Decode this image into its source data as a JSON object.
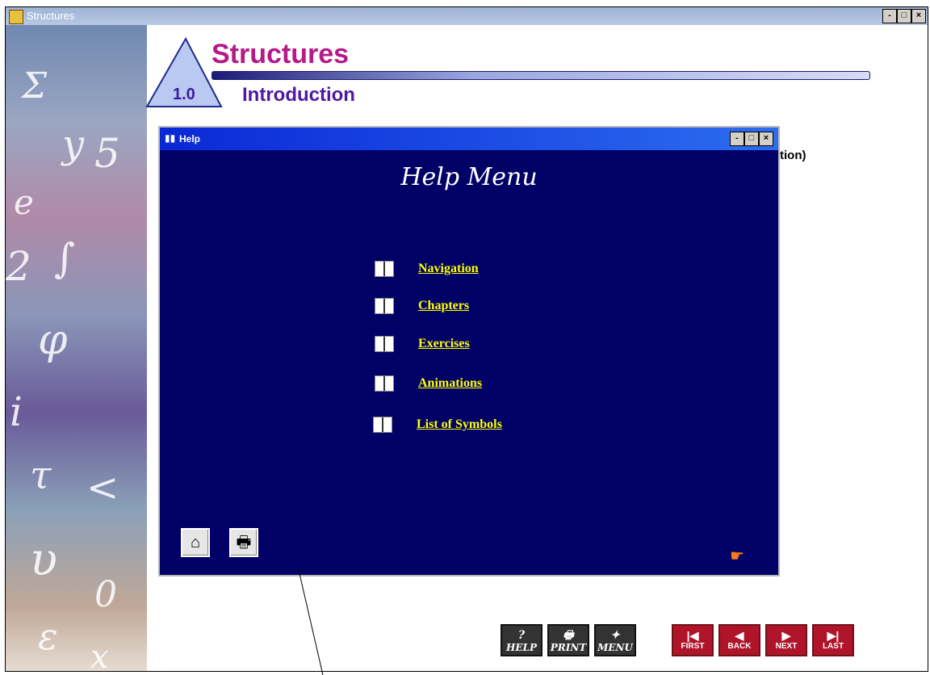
{
  "app": {
    "title": "Structures",
    "controls": [
      "-",
      "□",
      "×"
    ]
  },
  "chapter": {
    "title": "Structures",
    "section_number": "1.0",
    "section_title": "Introduction",
    "obscured_text": "tion)"
  },
  "help_window": {
    "title": "Help",
    "heading": "Help Menu",
    "items": [
      {
        "label": "Navigation"
      },
      {
        "label": "Chapters"
      },
      {
        "label": "Exercises"
      },
      {
        "label": "Animations"
      },
      {
        "label": "List of Symbols"
      }
    ],
    "controls": [
      "-",
      "□",
      "×"
    ]
  },
  "nav_buttons": {
    "tools": [
      {
        "label": "HELP",
        "icon": "?"
      },
      {
        "label": "PRINT",
        "icon": "🖶"
      },
      {
        "label": "MENU",
        "icon": "✦"
      }
    ],
    "pages": [
      {
        "label": "FIRST",
        "icon": "|◀"
      },
      {
        "label": "BACK",
        "icon": "◀"
      },
      {
        "label": "NEXT",
        "icon": "▶"
      },
      {
        "label": "LAST",
        "icon": "▶|"
      }
    ]
  },
  "icons": {
    "app": "app-icon",
    "help_home": "home-icon",
    "help_print": "printer-icon",
    "help_pointer": "pointing-hand-icon"
  },
  "colors": {
    "help_bg": "#000066",
    "link": "#ffff00",
    "title_magenta": "#b5198a",
    "subtitle_purple": "#4c19a0",
    "nav_red": "#b0142a"
  }
}
